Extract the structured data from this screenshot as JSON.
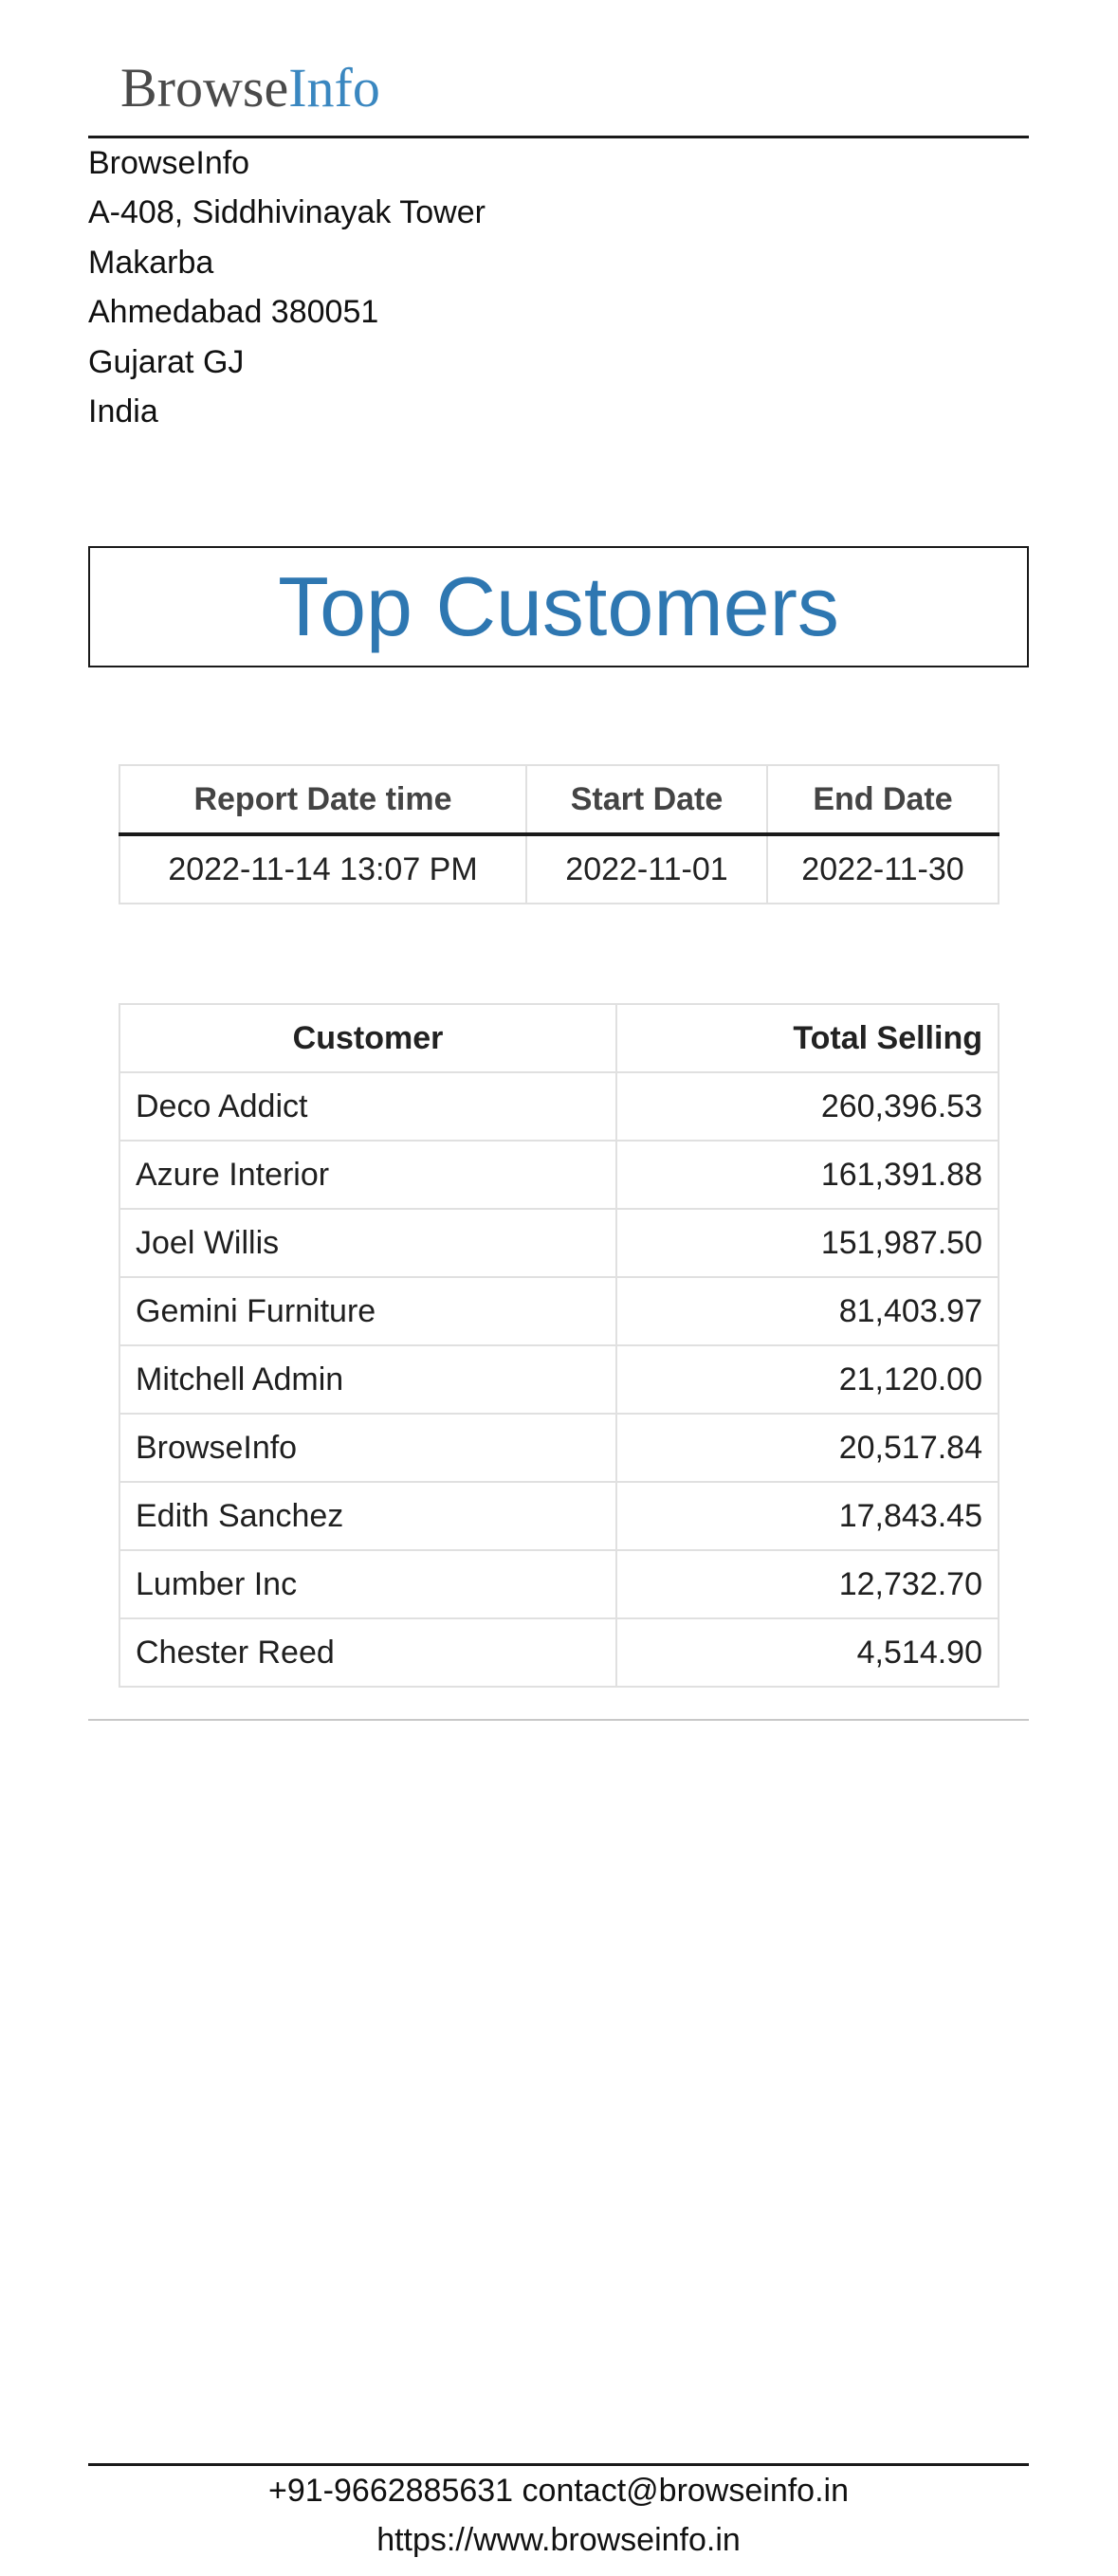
{
  "logo": {
    "part1": "Browse",
    "part2": "Info"
  },
  "company_address": {
    "name": "BrowseInfo",
    "line1": "A-408, Siddhivinayak Tower",
    "line2": "Makarba",
    "city_zip": "Ahmedabad 380051",
    "state": "Gujarat GJ",
    "country": "India"
  },
  "report_title": "Top Customers",
  "report_meta": {
    "headers": [
      "Report Date time",
      "Start Date",
      "End Date"
    ],
    "values": [
      "2022-11-14 13:07 PM",
      "2022-11-01",
      "2022-11-30"
    ]
  },
  "customers_table": {
    "headers": [
      "Customer",
      "Total Selling"
    ],
    "rows": [
      {
        "customer": "Deco Addict",
        "total": "260,396.53"
      },
      {
        "customer": "Azure Interior",
        "total": "161,391.88"
      },
      {
        "customer": "Joel Willis",
        "total": "151,987.50"
      },
      {
        "customer": "Gemini Furniture",
        "total": "81,403.97"
      },
      {
        "customer": "Mitchell Admin",
        "total": "21,120.00"
      },
      {
        "customer": "BrowseInfo",
        "total": "20,517.84"
      },
      {
        "customer": "Edith Sanchez",
        "total": "17,843.45"
      },
      {
        "customer": "Lumber Inc",
        "total": "12,732.70"
      },
      {
        "customer": "Chester Reed",
        "total": "4,514.90"
      }
    ]
  },
  "footer": {
    "contact": "+91-9662885631 contact@browseinfo.in",
    "website": "https://www.browseinfo.in"
  },
  "colors": {
    "title": "#2e77b1",
    "logo_accent": "#3a87c0",
    "logo_text": "#4a4a4a"
  }
}
